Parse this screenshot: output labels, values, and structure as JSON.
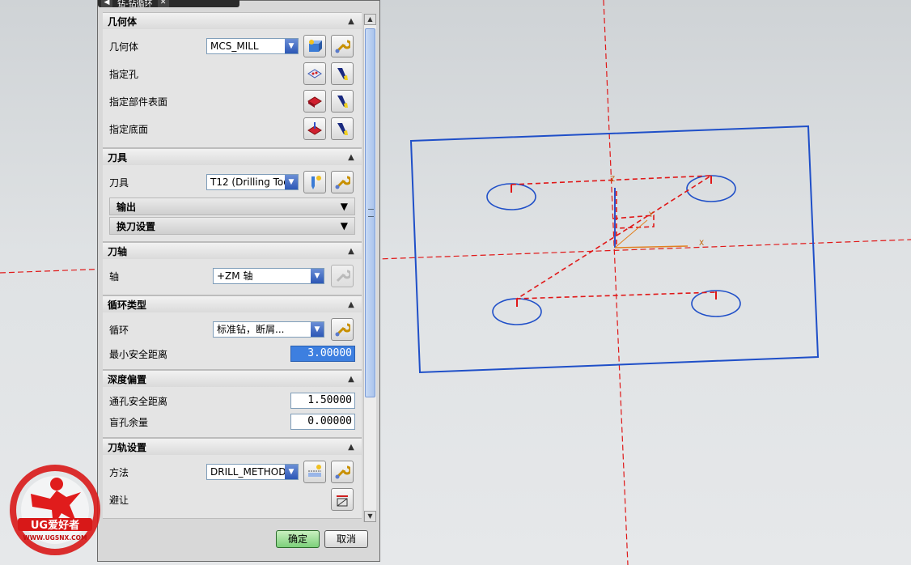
{
  "dialog": {
    "title": "钻-钻循环",
    "sections": {
      "geometry": {
        "header": "几何体",
        "geometry_label": "几何体",
        "geometry_value": "MCS_MILL",
        "specify_holes": "指定孔",
        "specify_part_surface": "指定部件表面",
        "specify_bottom": "指定底面"
      },
      "tool": {
        "header": "刀具",
        "tool_label": "刀具",
        "tool_value": "T12 (Drilling Too",
        "output": "输出",
        "tool_change": "换刀设置"
      },
      "axis": {
        "header": "刀轴",
        "axis_label": "轴",
        "axis_value": "+ZM 轴"
      },
      "cycle": {
        "header": "循环类型",
        "cycle_label": "循环",
        "cycle_value": "标准钻，断屑...",
        "min_clearance_label": "最小安全距离",
        "min_clearance_value": "3.00000"
      },
      "depth_offset": {
        "header": "深度偏置",
        "through_clearance_label": "通孔安全距离",
        "through_clearance_value": "1.50000",
        "blind_stock_label": "盲孔余量",
        "blind_stock_value": "0.00000"
      },
      "path": {
        "header": "刀轨设置",
        "method_label": "方法",
        "method_value": "DRILL_METHOD",
        "avoid_label": "避让"
      }
    },
    "buttons": {
      "ok": "确定",
      "cancel": "取消"
    }
  },
  "watermark": {
    "brand": "UG爱好者",
    "url": "WWW.UGSNX.COM"
  },
  "viewport": {
    "axis_labels": {
      "x": "X",
      "y": "Y",
      "z": "Z"
    }
  },
  "colors": {
    "part_outline": "#1f4fc8",
    "toolpath": "#e01818",
    "ok_button": "#7dd07a"
  }
}
